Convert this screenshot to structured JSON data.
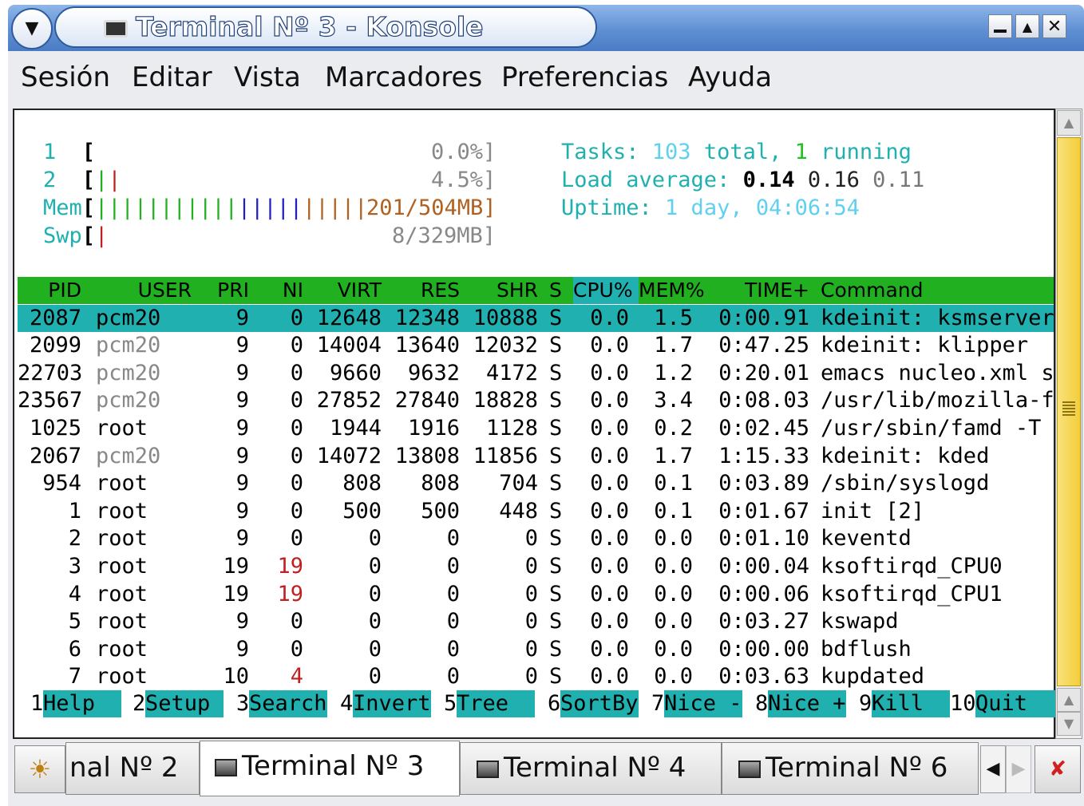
{
  "window": {
    "title": "Terminal Nº 3 - Konsole"
  },
  "menubar": [
    "Sesión",
    "Editar",
    "Vista",
    "Marcadores",
    "Preferencias",
    "Ayuda"
  ],
  "meters": {
    "cpu1": {
      "label": "1",
      "value": "0.0%]"
    },
    "cpu2": {
      "label": "2",
      "value": "4.5%]"
    },
    "mem": {
      "label": "Mem",
      "value": "201/504MB]"
    },
    "swp": {
      "label": "Swp",
      "value": "8/329MB]"
    }
  },
  "summary": {
    "tasks_label": "Tasks: ",
    "tasks_total": "103",
    "tasks_mid": " total, ",
    "tasks_running": "1",
    "tasks_end": " running",
    "load_label": "Load average: ",
    "load1": "0.14",
    "load5": "0.16",
    "load15": "0.11",
    "uptime_label": "Uptime: ",
    "uptime_value": "1 day, 04:06:54"
  },
  "header": [
    "PID",
    "USER",
    "PRI",
    "NI",
    "VIRT",
    "RES",
    "SHR",
    "S",
    "CPU%",
    "MEM%",
    "TIME+",
    "Command"
  ],
  "processes": [
    [
      "2087",
      "pcm20",
      "9",
      "0",
      "12648",
      "12348",
      "10888",
      "S",
      "0.0",
      "1.5",
      "0:00.91",
      "kdeinit: ksmserver"
    ],
    [
      "2099",
      "pcm20",
      "9",
      "0",
      "14004",
      "13640",
      "12032",
      "S",
      "0.0",
      "1.7",
      "0:47.25",
      "kdeinit: klipper"
    ],
    [
      "22703",
      "pcm20",
      "9",
      "0",
      "9660",
      "9632",
      "4172",
      "S",
      "0.0",
      "1.2",
      "0:20.01",
      "emacs nucleo.xml s"
    ],
    [
      "23567",
      "pcm20",
      "9",
      "0",
      "27852",
      "27840",
      "18828",
      "S",
      "0.0",
      "3.4",
      "0:08.03",
      "/usr/lib/mozilla-f"
    ],
    [
      "1025",
      "root",
      "9",
      "0",
      "1944",
      "1916",
      "1128",
      "S",
      "0.0",
      "0.2",
      "0:02.45",
      "/usr/sbin/famd -T"
    ],
    [
      "2067",
      "pcm20",
      "9",
      "0",
      "14072",
      "13808",
      "11856",
      "S",
      "0.0",
      "1.7",
      "1:15.33",
      "kdeinit: kded"
    ],
    [
      "954",
      "root",
      "9",
      "0",
      "808",
      "808",
      "704",
      "S",
      "0.0",
      "0.1",
      "0:03.89",
      "/sbin/syslogd"
    ],
    [
      "1",
      "root",
      "9",
      "0",
      "500",
      "500",
      "448",
      "S",
      "0.0",
      "0.1",
      "0:01.67",
      "init [2]"
    ],
    [
      "2",
      "root",
      "9",
      "0",
      "0",
      "0",
      "0",
      "S",
      "0.0",
      "0.0",
      "0:01.10",
      "keventd"
    ],
    [
      "3",
      "root",
      "19",
      "19",
      "0",
      "0",
      "0",
      "S",
      "0.0",
      "0.0",
      "0:00.04",
      "ksoftirqd_CPU0"
    ],
    [
      "4",
      "root",
      "19",
      "19",
      "0",
      "0",
      "0",
      "S",
      "0.0",
      "0.0",
      "0:00.06",
      "ksoftirqd_CPU1"
    ],
    [
      "5",
      "root",
      "9",
      "0",
      "0",
      "0",
      "0",
      "S",
      "0.0",
      "0.0",
      "0:03.27",
      "kswapd"
    ],
    [
      "6",
      "root",
      "9",
      "0",
      "0",
      "0",
      "0",
      "S",
      "0.0",
      "0.0",
      "0:00.00",
      "bdflush"
    ],
    [
      "7",
      "root",
      "10",
      "4",
      "0",
      "0",
      "0",
      "S",
      "0.0",
      "0.0",
      "0:03.63",
      "kupdated"
    ]
  ],
  "fkeys": [
    {
      "num": "1",
      "label": "Help  "
    },
    {
      "num": "2",
      "label": "Setup "
    },
    {
      "num": "3",
      "label": "Search"
    },
    {
      "num": "4",
      "label": "Invert"
    },
    {
      "num": "5",
      "label": "Tree  "
    },
    {
      "num": "6",
      "label": "SortBy"
    },
    {
      "num": "7",
      "label": "Nice -"
    },
    {
      "num": "8",
      "label": "Nice +"
    },
    {
      "num": "9",
      "label": "Kill  "
    },
    {
      "num": "10",
      "label": "Quit  "
    }
  ],
  "tabs": [
    "nal Nº 2",
    "Terminal Nº 3",
    "Terminal Nº 4",
    "Terminal Nº 6"
  ],
  "colors": {
    "header_bg": "#20b020",
    "selected_bg": "#20b0b0",
    "cyan_text": "#20b0b0",
    "green_text": "#20c020",
    "red_text": "#c02020",
    "blue_bar": "#2020c0",
    "brown_text": "#b06020"
  }
}
